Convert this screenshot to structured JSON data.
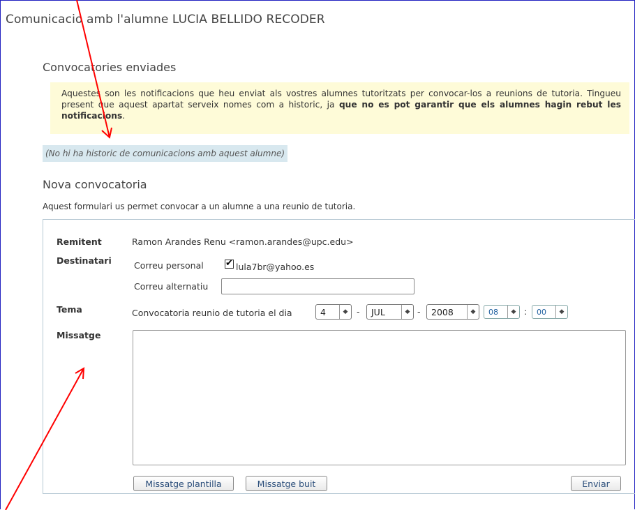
{
  "page": {
    "title": "Comunicacio amb l'alumne LUCIA BELLIDO RECODER"
  },
  "sent": {
    "heading": "Convocatories enviades",
    "notice_text1": "Aquestes son les notificacions que heu enviat als vostres alumnes tutoritzats per convocar-los a reunions de tutoria. Tingueu present que aquest apartat serveix nomes com a historic, ja ",
    "notice_bold": "que no es pot garantir que els alumnes hagin rebut les notificacions",
    "notice_end": ".",
    "no_history": "(No hi ha historic de comunicacions amb aquest alumne)"
  },
  "new": {
    "heading": "Nova convocatoria",
    "intro": "Aquest formulari us permet convocar a un alumne a una reunio de tutoria."
  },
  "form": {
    "sender_label": "Remitent",
    "sender_value": "Ramon Arandes Renu <ramon.arandes@upc.edu>",
    "recipient_label": "Destinatari",
    "personal_email_label": "Correu personal",
    "personal_email_checked": true,
    "personal_email_value": "lula7br@yahoo.es",
    "alt_email_label": "Correu alternatiu",
    "alt_email_value": "",
    "subject_label": "Tema",
    "subject_text": "Convocatoria reunio de tutoria el dia",
    "day": "4",
    "month": "JUL",
    "year": "2008",
    "hour": "08",
    "minute": "00",
    "date_sep": "-",
    "time_sep": ":",
    "message_label": "Missatge",
    "message_value": ""
  },
  "buttons": {
    "template": "Missatge plantilla",
    "empty": "Missatge buit",
    "send": "Enviar"
  },
  "icons": {
    "select_arrow": "updown-chevron-icon",
    "checkmark": "checkmark-icon"
  },
  "colors": {
    "notice_bg": "#fefbd8",
    "no_history_bg": "#d8e8ef",
    "annotation_arrow": "#ff0000",
    "frame_border": "#2020c0"
  }
}
